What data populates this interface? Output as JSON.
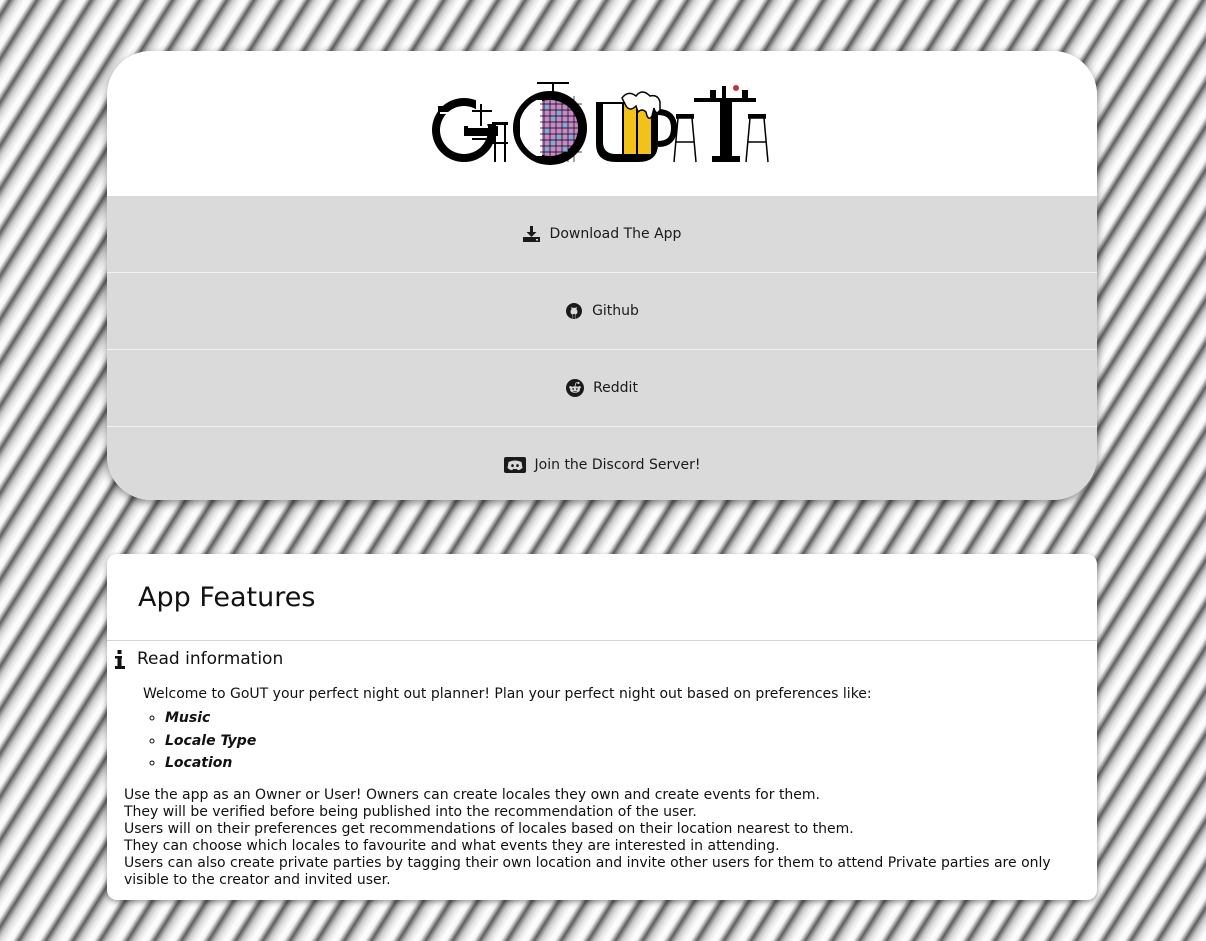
{
  "logo": {
    "alt": "GoUT"
  },
  "links": [
    {
      "label": "Download The App",
      "icon": "download-icon"
    },
    {
      "label": "Github",
      "icon": "github-icon"
    },
    {
      "label": "Reddit",
      "icon": "reddit-icon"
    },
    {
      "label": "Join the Discord Server!",
      "icon": "discord-icon"
    }
  ],
  "features": {
    "title": "App Features",
    "section_heading": "Read information",
    "welcome": "Welcome to GoUT your perfect night out planner! Plan your perfect night out based on preferences like:",
    "preferences": [
      "Music",
      "Locale Type",
      "Location"
    ],
    "description": [
      "Use the app as an Owner or User! Owners can create locales they own and create events for them.",
      "They will be verified before being published into the recommendation of the user.",
      "Users will on their preferences get recommendations of locales based on their location nearest to them.",
      "They can choose which locales to favourite and what events they are interested in attending.",
      "Users can also create private parties by tagging their own location and invite other users for them to attend Private parties are only visible to the creator and invited user."
    ]
  },
  "colors": {
    "link_background": "#dadada",
    "card_background": "#ffffff",
    "text": "#1a1a1a",
    "logo_black": "#000000",
    "logo_purple": "#c889c8",
    "logo_blue": "#8ea3d8",
    "logo_yellow": "#f2c21a"
  }
}
